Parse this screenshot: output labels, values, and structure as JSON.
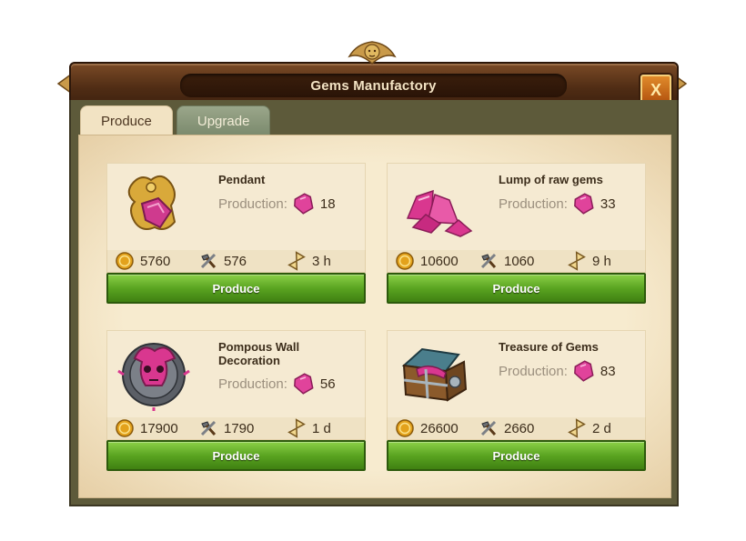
{
  "window": {
    "title": "Gems Manufactory",
    "close_label": "X"
  },
  "tabs": [
    {
      "label": "Produce",
      "active": true
    },
    {
      "label": "Upgrade",
      "active": false
    }
  ],
  "production_label": "Production:",
  "button_label": "Produce",
  "items": [
    {
      "name": "Pendant",
      "production": "18",
      "coins": "5760",
      "supplies": "576",
      "time": "3 h",
      "icon": "pendant-icon"
    },
    {
      "name": "Lump of raw gems",
      "production": "33",
      "coins": "10600",
      "supplies": "1060",
      "time": "9 h",
      "icon": "raw-gems-icon"
    },
    {
      "name": "Pompous Wall Decoration",
      "production": "56",
      "coins": "17900",
      "supplies": "1790",
      "time": "1 d",
      "icon": "wall-decoration-icon"
    },
    {
      "name": "Treasure of Gems",
      "production": "83",
      "coins": "26600",
      "supplies": "2660",
      "time": "2 d",
      "icon": "treasure-chest-icon"
    }
  ],
  "icons": {
    "resource": "gem-icon",
    "coins": "coin-icon",
    "supplies": "hammer-icon",
    "time": "hourglass-icon"
  },
  "colors": {
    "frame": "#5a3418",
    "button": "#5aa421",
    "gem": "#e0439b",
    "coin": "#e3a21c"
  }
}
